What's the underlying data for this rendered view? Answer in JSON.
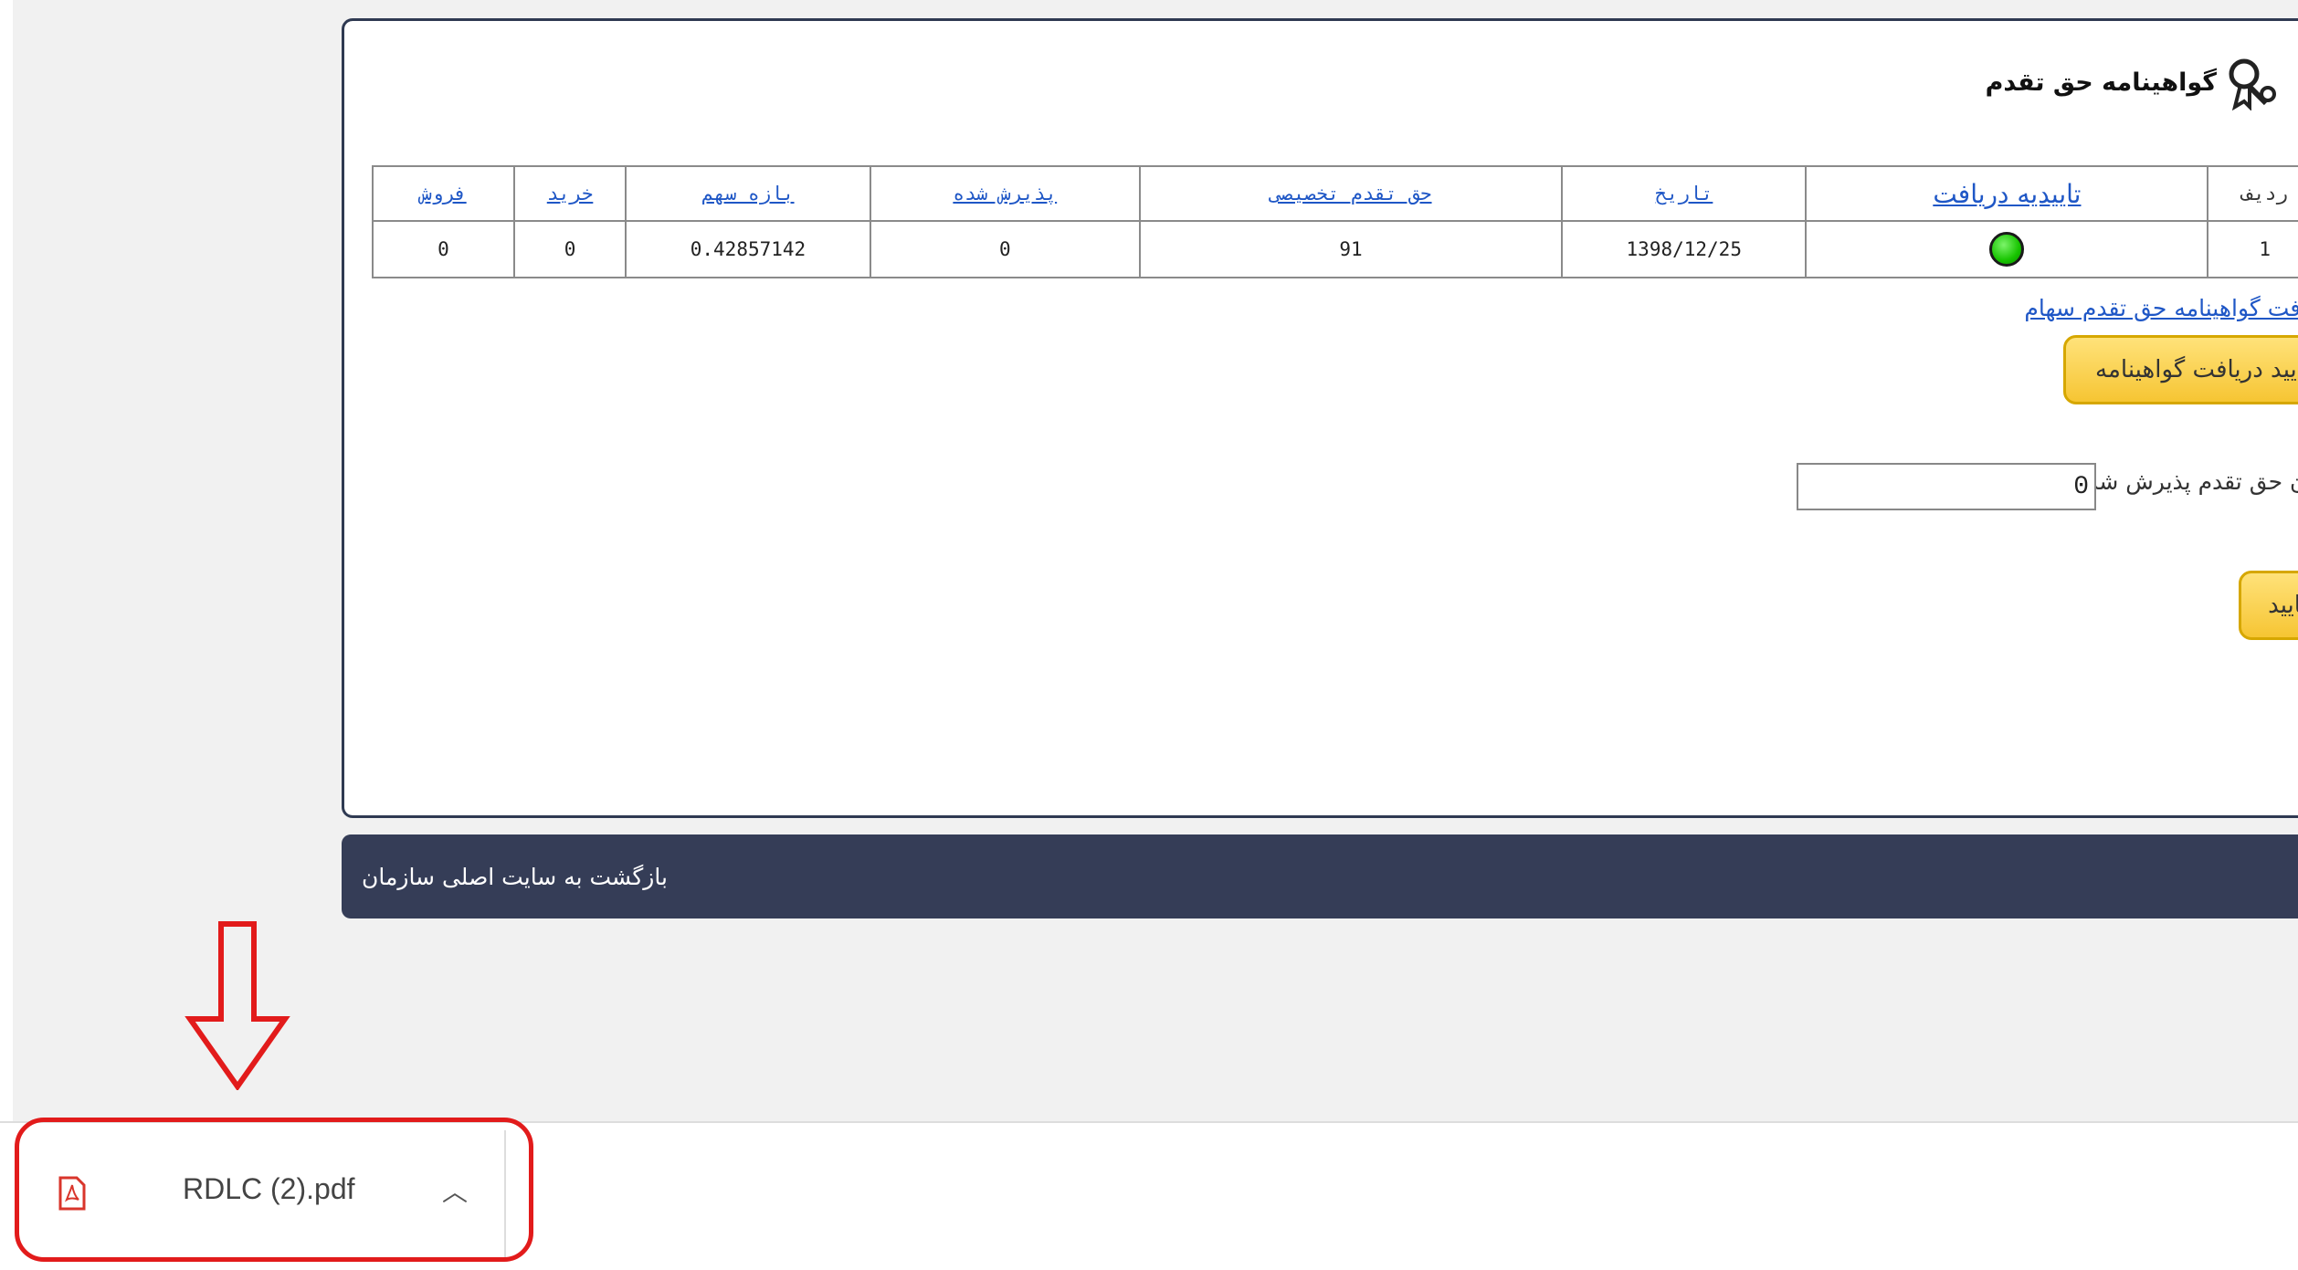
{
  "panel": {
    "title": "گواهینامه حق تقدم",
    "table": {
      "headers": [
        "ردیف",
        "تاییدیه دریافت",
        "تاریخ",
        "حق تقدم تخصیصی",
        "پذیرش شده",
        "بازه سهم",
        "خرید",
        "فروش"
      ],
      "row": {
        "index": "1",
        "status": "green",
        "date": "1398/12/25",
        "allotted": "91",
        "accepted": "0",
        "share_range": "0.42857142",
        "buy": "0",
        "sell": "0"
      }
    },
    "cert_link": "دریافت گواهینامه حق تقدم سهام",
    "confirm_cert_button": "تایید دریافت گواهینامه",
    "accepted_label": "میزان حق تقدم پذیرش شده :",
    "accepted_value": "0",
    "confirm_button": "تایید"
  },
  "footer": {
    "back_link": "بازگشت به سایت اصلی سازمان"
  },
  "download_bar": {
    "file_name": "RDLC (2).pdf"
  },
  "colors": {
    "accent_blue": "#1f57c6",
    "header_bar": "#353d57",
    "button_yellow": "#f6c533",
    "highlight_red": "#e21b1b",
    "status_green": "#17c400"
  }
}
